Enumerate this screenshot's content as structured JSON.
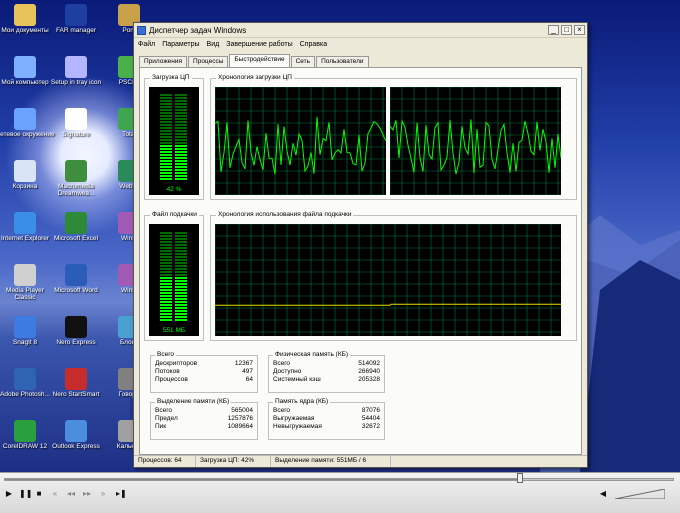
{
  "desktop": {
    "icons_left": [
      {
        "label": "Мои документы",
        "icon": "my-documents-icon"
      },
      {
        "label": "Мой компьютер",
        "icon": "my-computer-icon"
      },
      {
        "label": "Сетевое окружение",
        "icon": "network-places-icon"
      },
      {
        "label": "Корзина",
        "icon": "recycle-bin-icon"
      },
      {
        "label": "Internet Explorer",
        "icon": "internet-explorer-icon"
      },
      {
        "label": "Media Player Classic",
        "icon": "media-player-icon"
      },
      {
        "label": "SnagIt 8",
        "icon": "snagit-icon"
      },
      {
        "label": "Adobe Photosh...",
        "icon": "photoshop-icon"
      },
      {
        "label": "CorelDRAW 12",
        "icon": "coreldraw-icon"
      }
    ],
    "icons_mid": [
      {
        "label": "FAR manager",
        "icon": "far-manager-icon"
      },
      {
        "label": "Setup in tray icon",
        "icon": "tray-setup-icon"
      },
      {
        "label": "Signature",
        "icon": "signature-icon"
      },
      {
        "label": "Macromedia Dreamwea...",
        "icon": "dreamweaver-icon"
      },
      {
        "label": "Microsoft Excel",
        "icon": "excel-icon"
      },
      {
        "label": "Microsoft Word",
        "icon": "word-icon"
      },
      {
        "label": "Nero Express",
        "icon": "nero-express-icon"
      },
      {
        "label": "Nero StartSmart",
        "icon": "nero-startsmart-icon"
      },
      {
        "label": "Outlook Express",
        "icon": "outlook-express-icon"
      }
    ],
    "icons_right": [
      {
        "label": "Porti",
        "icon": "portable-icon"
      },
      {
        "label": "PSCIIh",
        "icon": "pscii-icon"
      },
      {
        "label": "Total",
        "icon": "total-icon"
      },
      {
        "label": "WebW",
        "icon": "webw-icon"
      },
      {
        "label": "WinR",
        "icon": "winrar-icon"
      },
      {
        "label": "WinR",
        "icon": "winrar2-icon"
      },
      {
        "label": "Блокн",
        "icon": "notepad-icon"
      },
      {
        "label": "Говорн",
        "icon": "narrator-icon"
      },
      {
        "label": "Калькул",
        "icon": "calculator-icon"
      }
    ]
  },
  "window": {
    "title": "Диспетчер задач Windows",
    "menu": [
      "Файл",
      "Параметры",
      "Вид",
      "Завершение работы",
      "Справка"
    ],
    "tabs": [
      {
        "label": "Приложения",
        "active": false
      },
      {
        "label": "Процессы",
        "active": false
      },
      {
        "label": "Быстродействие",
        "active": true
      },
      {
        "label": "Сеть",
        "active": false
      },
      {
        "label": "Пользователи",
        "active": false
      }
    ],
    "cpu_group_label": "Загрузка ЦП",
    "cpu_value": "42 %",
    "cpu_level": 0.42,
    "cpu_history_label": "Хронология загрузки ЦП",
    "pf_group_label": "Файл подкачки",
    "pf_value": "551 МБ",
    "pf_level": 0.5,
    "pf_history_label": "Хронология использования файла подкачки",
    "totals": {
      "title": "Всего",
      "rows": [
        {
          "label": "Дескрипторов",
          "value": "12367"
        },
        {
          "label": "Потоков",
          "value": "497"
        },
        {
          "label": "Процессов",
          "value": "64"
        }
      ]
    },
    "physical": {
      "title": "Физическая память (КБ)",
      "rows": [
        {
          "label": "Всего",
          "value": "514092"
        },
        {
          "label": "Доступно",
          "value": "266940"
        },
        {
          "label": "Системный кэш",
          "value": "205328"
        }
      ]
    },
    "commit": {
      "title": "Выделение памяти (КБ)",
      "rows": [
        {
          "label": "Всего",
          "value": "565004"
        },
        {
          "label": "Предел",
          "value": "1257876"
        },
        {
          "label": "Пик",
          "value": "1089664"
        }
      ]
    },
    "kernel": {
      "title": "Память ядра (КБ)",
      "rows": [
        {
          "label": "Всего",
          "value": "87076"
        },
        {
          "label": "Выгружаемая",
          "value": "54404"
        },
        {
          "label": "Невыгружаемая",
          "value": "32672"
        }
      ]
    },
    "status": {
      "processes": "Процессов: 64",
      "cpu": "Загрузка ЦП: 42%",
      "commit": "Выделение памяти: 551МБ / 6"
    }
  },
  "player": {
    "seek_position": 0.77,
    "volume_level": 0.0
  }
}
